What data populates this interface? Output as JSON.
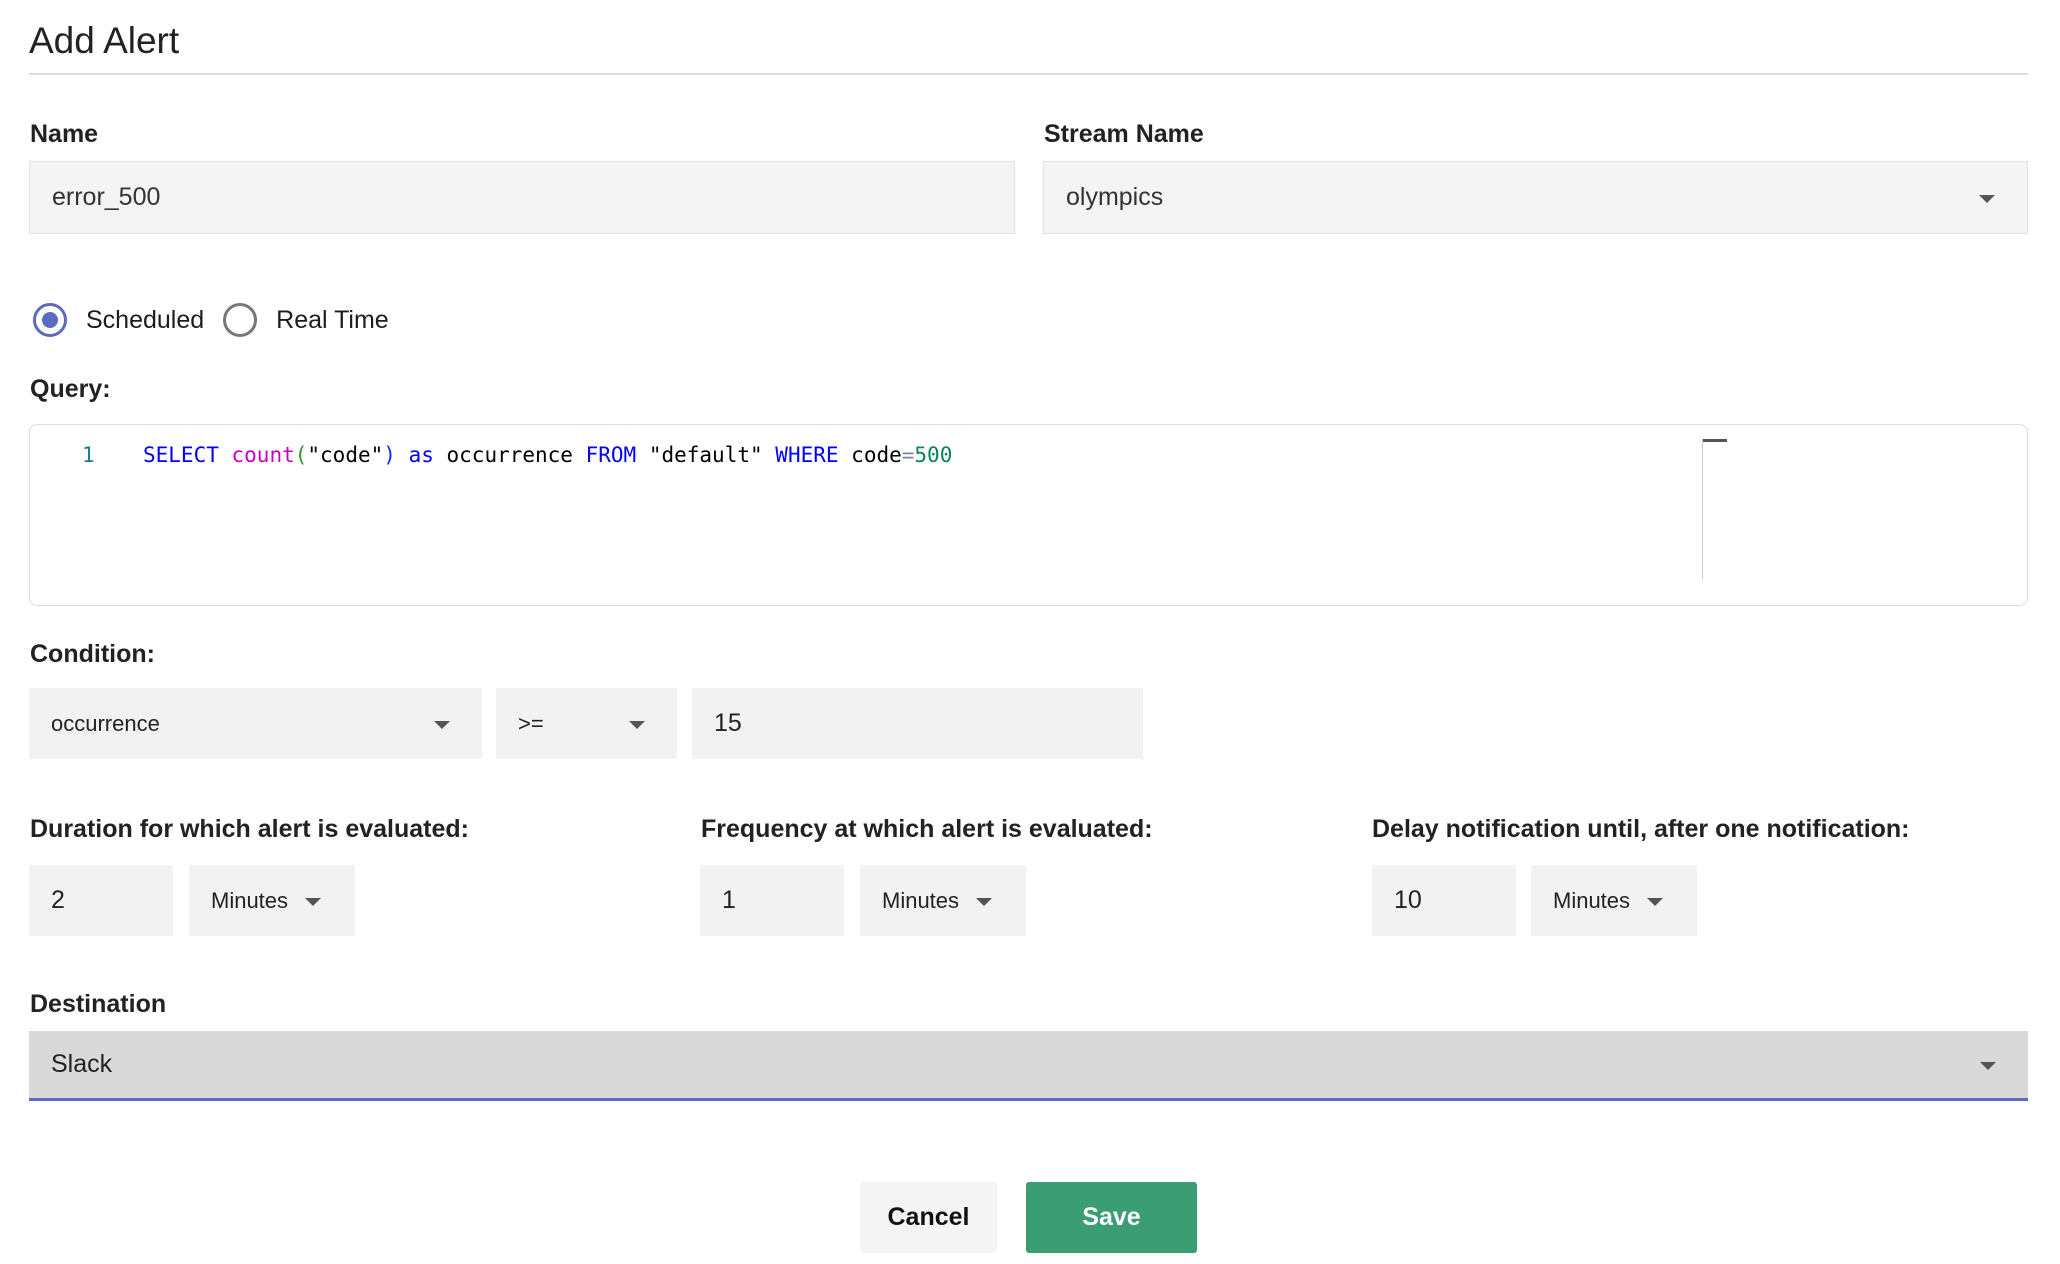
{
  "title": "Add Alert",
  "name": {
    "label": "Name",
    "value": "error_500"
  },
  "stream": {
    "label": "Stream Name",
    "value": "olympics"
  },
  "alert_type": {
    "options": [
      "Scheduled",
      "Real Time"
    ],
    "selected": "Scheduled"
  },
  "query": {
    "label": "Query:",
    "line_number": "1",
    "tokens": {
      "select": "SELECT",
      "count": "count",
      "open": "(",
      "arg": "\"code\"",
      "close": ")",
      "as": "as",
      "alias": "occurrence",
      "from": "FROM",
      "table": "\"default\"",
      "where": "WHERE",
      "col": "code",
      "eq": "=",
      "num": "500"
    }
  },
  "condition": {
    "label": "Condition:",
    "column": "occurrence",
    "operator": ">=",
    "value": "15"
  },
  "duration": {
    "label": "Duration for which alert is evaluated:",
    "value": "2",
    "unit": "Minutes"
  },
  "frequency": {
    "label": "Frequency at which alert is evaluated:",
    "value": "1",
    "unit": "Minutes"
  },
  "delay": {
    "label": "Delay notification until, after one notification:",
    "value": "10",
    "unit": "Minutes"
  },
  "destination": {
    "label": "Destination",
    "value": "Slack"
  },
  "buttons": {
    "cancel": "Cancel",
    "save": "Save"
  },
  "colors": {
    "accent": "#5c6bc0",
    "save": "#3a9d74"
  }
}
